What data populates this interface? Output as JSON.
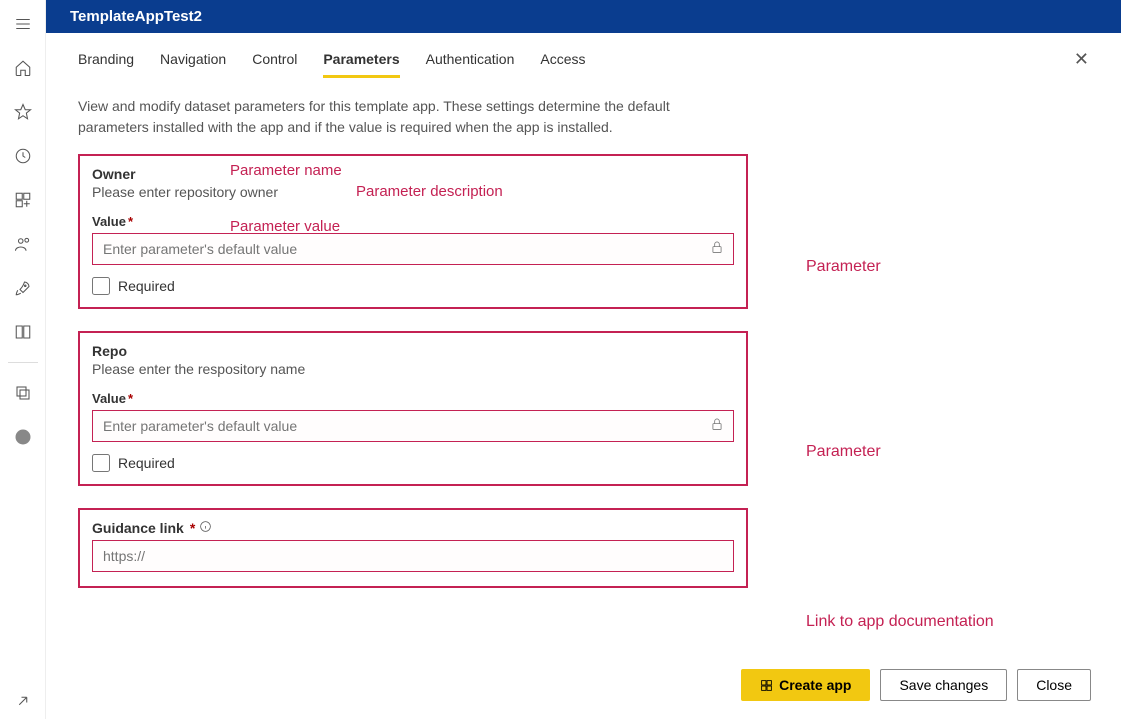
{
  "title": "TemplateAppTest2",
  "tabs": [
    "Branding",
    "Navigation",
    "Control",
    "Parameters",
    "Authentication",
    "Access"
  ],
  "active_tab": "Parameters",
  "description": "View and modify dataset parameters for this template app. These settings determine the default parameters installed with the app and if the value is required when the app is installed.",
  "params": [
    {
      "name": "Owner",
      "desc": "Please enter repository owner",
      "value_label": "Value",
      "placeholder": "Enter parameter's default value",
      "required_label": "Required"
    },
    {
      "name": "Repo",
      "desc": "Please enter the respository name",
      "value_label": "Value",
      "placeholder": "Enter parameter's default value",
      "required_label": "Required"
    }
  ],
  "guidance": {
    "label": "Guidance link",
    "placeholder": "https://"
  },
  "buttons": {
    "create": "Create app",
    "save": "Save changes",
    "close": "Close"
  },
  "annotations": {
    "pname": "Parameter name",
    "pdesc": "Parameter description",
    "pval": "Parameter value",
    "param": "Parameter",
    "link": "Link to app documentation"
  }
}
